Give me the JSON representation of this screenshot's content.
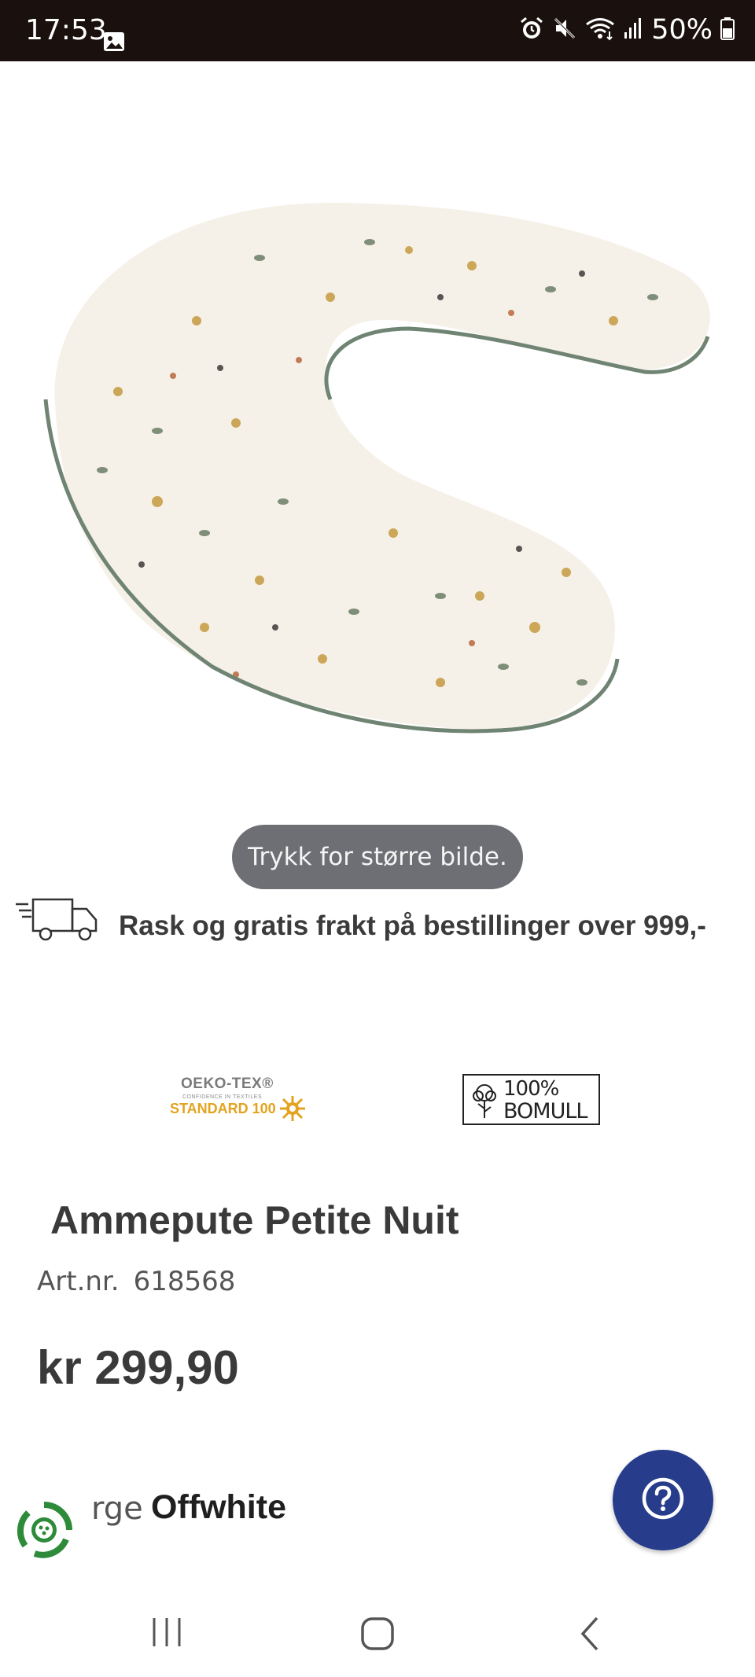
{
  "status_bar": {
    "time": "17:53",
    "battery": "50%",
    "icons": [
      "gallery-icon",
      "alarm-icon",
      "mute-icon",
      "wifi-icon",
      "signal-icon",
      "battery-icon"
    ]
  },
  "product": {
    "image_alt": "Ammepute Petite Nuit",
    "zoom_hint": "Trykk for større bilde.",
    "shipping_text": "Rask og gratis frakt på bestillinger over 999,-",
    "badges": {
      "oeko_line1": "OEKO-TEX®",
      "oeko_line2": "CONFIDENCE IN TEXTILES",
      "oeko_line3": "STANDARD 100",
      "cotton_line1": "100%",
      "cotton_line2": "BOMULL"
    },
    "title": "Ammepute Petite Nuit",
    "art_label": "Art.nr.",
    "art_number": "618568",
    "price": "kr 299,90",
    "color_label": "rge",
    "color_value": "Offwhite"
  },
  "colors": {
    "status_bg": "#1a110e",
    "help_button": "#273d8c",
    "eco_green": "#2e8b3a",
    "oeko_yellow": "#e3a31f",
    "pillow_piping": "#6f8473"
  }
}
